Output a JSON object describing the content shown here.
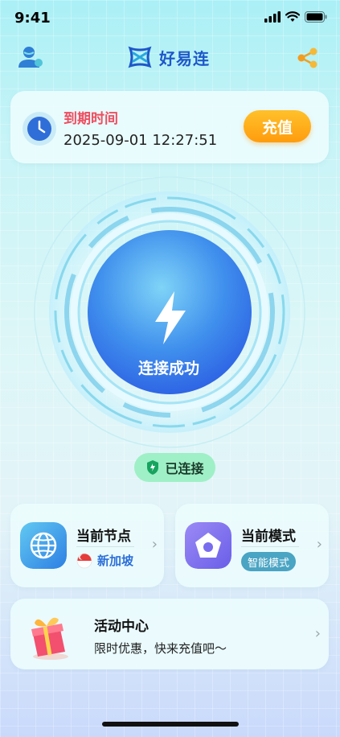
{
  "status_bar": {
    "time": "9:41"
  },
  "header": {
    "app_name": "好易连"
  },
  "expiry": {
    "label": "到期时间",
    "date": "2025-09-01 12:27:51",
    "recharge_label": "充值"
  },
  "connection": {
    "button_text": "连接成功",
    "status_text": "已连接"
  },
  "node": {
    "title": "当前节点",
    "value": "新加坡"
  },
  "mode": {
    "title": "当前模式",
    "value": "智能模式"
  },
  "activity": {
    "title": "活动中心",
    "description": "限时优惠，快来充值吧～"
  },
  "colors": {
    "brand_blue": "#1f57c9",
    "expiry_red": "#ef4e5f",
    "recharge_orange": "#ff9c0e",
    "connected_green": "#9ff0c6",
    "mode_badge": "#4aa4c3"
  },
  "icons": {
    "user": "user-icon",
    "logo": "logo-icon",
    "share": "share-icon",
    "clock": "clock-icon",
    "lightning": "lightning-icon",
    "shield": "shield-check-icon",
    "globe": "globe-icon",
    "flag": "singapore-flag-icon",
    "mode": "pentagon-icon",
    "gift": "gift-icon",
    "chevron": "chevron-right-icon"
  }
}
